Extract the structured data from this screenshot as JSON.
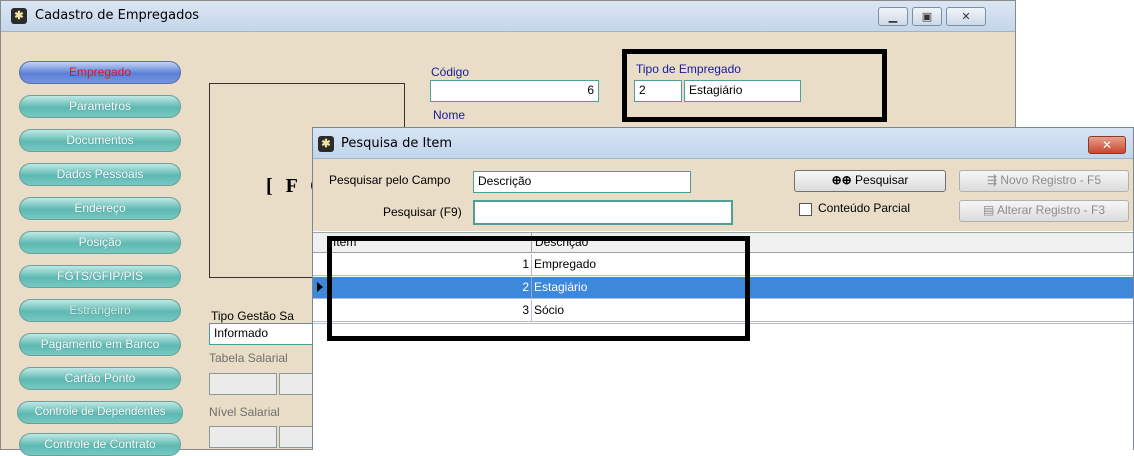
{
  "main_window": {
    "title": "Cadastro de Empregados",
    "controls": [
      "minimize",
      "maximize",
      "close"
    ]
  },
  "sidebar": {
    "items": [
      {
        "label": "Empregado",
        "state": "active"
      },
      {
        "label": "Parametros",
        "state": "normal"
      },
      {
        "label": "Documentos",
        "state": "normal"
      },
      {
        "label": "Dados Pessoais",
        "state": "normal"
      },
      {
        "label": "Endereço",
        "state": "normal"
      },
      {
        "label": "Posição",
        "state": "normal"
      },
      {
        "label": "FGTS/GFIP/PIS",
        "state": "normal"
      },
      {
        "label": "Estrangeiro",
        "state": "disabled"
      },
      {
        "label": "Pagamento em Banco",
        "state": "normal"
      },
      {
        "label": "Cartão Ponto",
        "state": "normal"
      },
      {
        "label": "Controle de Dependentes",
        "state": "normal"
      },
      {
        "label": "Controle de Contrato",
        "state": "normal"
      }
    ]
  },
  "form": {
    "photo_placeholder": "[ F O",
    "codigo_label": "Código",
    "codigo_value": "6",
    "nome_label": "Nome",
    "tipo_empregado_label": "Tipo de Empregado",
    "tipo_empregado_code": "2",
    "tipo_empregado_desc": "Estagiário",
    "tipo_gestao_label": "Tipo Gestão Sa",
    "tipo_gestao_value": "Informado",
    "tabela_salarial_label": "Tabela Salarial",
    "nivel_salarial_label": "Nível Salarial"
  },
  "dialog": {
    "title": "Pesquisa de Item",
    "pesquisar_campo_label": "Pesquisar pelo Campo",
    "pesquisar_campo_value": "Descrição",
    "pesquisar_f9_label": "Pesquisar (F9)",
    "pesquisar_f9_value": "",
    "pesquisar_button": "Pesquisar",
    "novo_registro_button": "Novo Registro - F5",
    "alterar_registro_button": "Alterar Registro - F3",
    "conteudo_parcial_label": "Conteúdo Parcial",
    "conteudo_parcial_checked": false,
    "grid": {
      "columns": [
        "Item",
        "Descrição"
      ],
      "rows": [
        {
          "item": "1",
          "descricao": "Empregado",
          "selected": false
        },
        {
          "item": "2",
          "descricao": "Estagiário",
          "selected": true
        },
        {
          "item": "3",
          "descricao": "Sócio",
          "selected": false
        }
      ]
    }
  },
  "colors": {
    "form_bg": "#e9ddc7",
    "sidebar_button": "#5eb8b2",
    "sidebar_active": "#5b7fd6",
    "active_text": "#e5121b",
    "selected_row": "#3d88da",
    "close_button": "#c8462f"
  }
}
